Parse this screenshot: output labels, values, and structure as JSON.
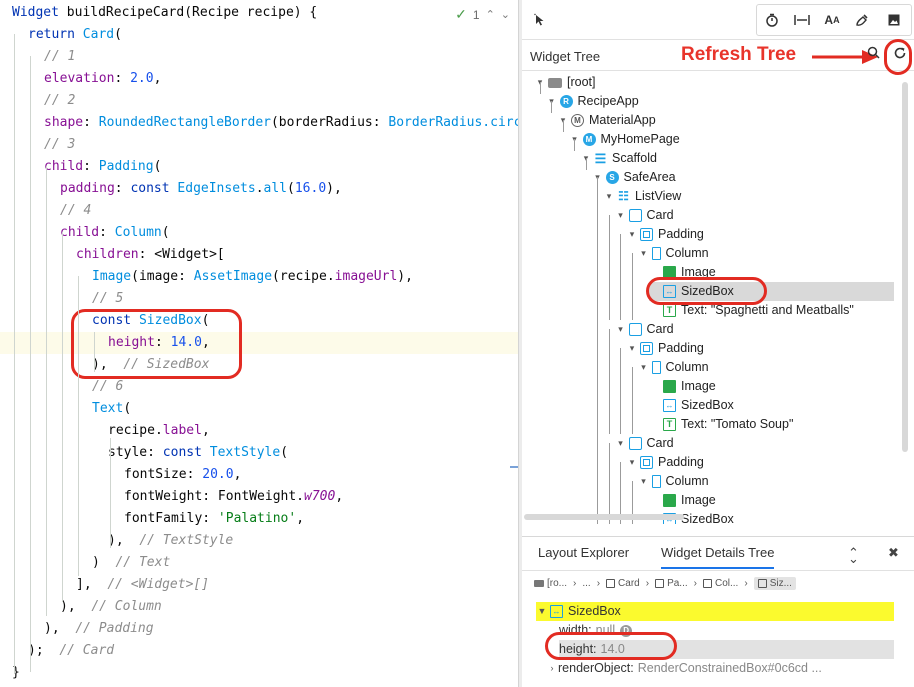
{
  "editor": {
    "status": {
      "warnings": "1"
    },
    "lines": [
      [
        [
          "k",
          "Widget "
        ],
        [
          "",
          "buildRecipeCard(Recipe recipe) {"
        ]
      ],
      [
        [
          "k",
          "return "
        ],
        [
          "t",
          "Card"
        ],
        [
          "",
          "("
        ]
      ],
      [
        [
          "c",
          "// 1"
        ]
      ],
      [
        [
          "p",
          "elevation"
        ],
        [
          "",
          ": "
        ],
        [
          "n",
          "2.0"
        ],
        [
          "",
          ","
        ]
      ],
      [
        [
          "c",
          "// 2"
        ]
      ],
      [
        [
          "p",
          "shape"
        ],
        [
          "",
          ": "
        ],
        [
          "t",
          "RoundedRectangleBorder"
        ],
        [
          "",
          "(borderRadius: "
        ],
        [
          "t",
          "BorderRadius.circ"
        ]
      ],
      [
        [
          "c",
          "// 3"
        ]
      ],
      [
        [
          "p",
          "child"
        ],
        [
          "",
          ": "
        ],
        [
          "t",
          "Padding"
        ],
        [
          "",
          "("
        ]
      ],
      [
        [
          "p",
          "padding"
        ],
        [
          "",
          ": "
        ],
        [
          "k",
          "const "
        ],
        [
          "t",
          "EdgeInsets"
        ],
        [
          "",
          "."
        ],
        [
          "t",
          "all"
        ],
        [
          "",
          "("
        ],
        [
          "n",
          "16.0"
        ],
        [
          "",
          "),"
        ]
      ],
      [
        [
          "c",
          "// 4"
        ]
      ],
      [
        [
          "p",
          "child"
        ],
        [
          "",
          ": "
        ],
        [
          "t",
          "Column"
        ],
        [
          "",
          "("
        ]
      ],
      [
        [
          "p",
          "children"
        ],
        [
          "",
          ": <Widget>["
        ]
      ],
      [
        [
          "t",
          "Image"
        ],
        [
          "",
          "(image: "
        ],
        [
          "t",
          "AssetImage"
        ],
        [
          "",
          "(recipe."
        ],
        [
          "p",
          "imageUrl"
        ],
        [
          "",
          "),"
        ]
      ],
      [
        [
          "c",
          "// 5"
        ]
      ],
      [
        [
          "k",
          "const "
        ],
        [
          "t",
          "SizedBox"
        ],
        [
          "",
          "("
        ]
      ],
      [
        [
          "p",
          "height"
        ],
        [
          "",
          ": "
        ],
        [
          "n",
          "14.0"
        ],
        [
          "",
          ","
        ]
      ],
      [
        [
          "",
          "),  "
        ],
        [
          "c",
          "// SizedBox"
        ]
      ],
      [
        [
          "c",
          "// 6"
        ]
      ],
      [
        [
          "t",
          "Text"
        ],
        [
          "",
          "("
        ]
      ],
      [
        [
          "",
          "recipe."
        ],
        [
          "p",
          "label"
        ],
        [
          "",
          ","
        ]
      ],
      [
        [
          "",
          "style: "
        ],
        [
          "k",
          "const "
        ],
        [
          "t",
          "TextStyle"
        ],
        [
          "",
          "("
        ]
      ],
      [
        [
          "",
          "fontSize: "
        ],
        [
          "n",
          "20.0"
        ],
        [
          "",
          ","
        ]
      ],
      [
        [
          "",
          "fontWeight: FontWeight."
        ],
        [
          "pi",
          "w700"
        ],
        [
          "",
          ","
        ]
      ],
      [
        [
          "",
          "fontFamily: "
        ],
        [
          "s",
          "'Palatino'"
        ],
        [
          "",
          ","
        ]
      ],
      [
        [
          "",
          "),  "
        ],
        [
          "c",
          "// TextStyle"
        ]
      ],
      [
        [
          "",
          ")  "
        ],
        [
          "c",
          "// Text"
        ]
      ],
      [
        [
          "",
          "],  "
        ],
        [
          "c",
          "// <Widget>[]"
        ]
      ],
      [
        [
          "",
          "),  "
        ],
        [
          "c",
          "// Column"
        ]
      ],
      [
        [
          "",
          "),  "
        ],
        [
          "c",
          "// Padding"
        ]
      ],
      [
        [
          "",
          ");  "
        ],
        [
          "c",
          "// Card"
        ]
      ],
      [
        [
          "",
          "}"
        ]
      ]
    ]
  },
  "toolbar": {
    "select_icon": "select-widget-mode-icon",
    "buttons": [
      "timer-icon",
      "baseline-icon",
      "text-size-icon",
      "paint-icon",
      "image-icon"
    ]
  },
  "widget_tree": {
    "title": "Widget Tree",
    "annotation": "Refresh Tree",
    "nodes": [
      {
        "label": "[root]",
        "icon": "folder",
        "level": 0
      },
      {
        "label": "RecipeApp",
        "icon": "circle",
        "level": 1
      },
      {
        "label": "MaterialApp",
        "icon": "circle-o",
        "level": 2
      },
      {
        "label": "MyHomePage",
        "icon": "circle",
        "level": 3
      },
      {
        "label": "Scaffold",
        "icon": "scaffold",
        "level": 4
      },
      {
        "label": "SafeArea",
        "icon": "circle",
        "level": 5
      },
      {
        "label": "ListView",
        "icon": "list",
        "level": 6
      },
      {
        "label": "Card",
        "icon": "card",
        "level": 7
      },
      {
        "label": "Padding",
        "icon": "padding",
        "level": 8
      },
      {
        "label": "Column",
        "icon": "column",
        "level": 9
      },
      {
        "label": "Image",
        "icon": "image",
        "level": 10
      },
      {
        "label": "SizedBox",
        "icon": "sized",
        "level": 10,
        "selected": true
      },
      {
        "label": "Text: \"Spaghetti and Meatballs\"",
        "icon": "text",
        "level": 10
      },
      {
        "label": "Card",
        "icon": "card",
        "level": 7
      },
      {
        "label": "Padding",
        "icon": "padding",
        "level": 8
      },
      {
        "label": "Column",
        "icon": "column",
        "level": 9
      },
      {
        "label": "Image",
        "icon": "image",
        "level": 10
      },
      {
        "label": "SizedBox",
        "icon": "sized",
        "level": 10
      },
      {
        "label": "Text: \"Tomato Soup\"",
        "icon": "text",
        "level": 10
      },
      {
        "label": "Card",
        "icon": "card",
        "level": 7
      },
      {
        "label": "Padding",
        "icon": "padding",
        "level": 8
      },
      {
        "label": "Column",
        "icon": "column",
        "level": 9
      },
      {
        "label": "Image",
        "icon": "image",
        "level": 10
      },
      {
        "label": "SizedBox",
        "icon": "sized",
        "level": 10
      }
    ]
  },
  "bottom": {
    "tabs": [
      "Layout Explorer",
      "Widget Details Tree"
    ],
    "active_tab": 1,
    "breadcrumbs": [
      {
        "label": "[ro...",
        "icon": "folder"
      },
      {
        "label": "...",
        "icon": ""
      },
      {
        "label": "Card",
        "icon": "card"
      },
      {
        "label": "Pa...",
        "icon": "padding"
      },
      {
        "label": "Col...",
        "icon": "column"
      },
      {
        "label": "Siz...",
        "icon": "sized",
        "selected": true
      }
    ],
    "details": {
      "node": "SizedBox",
      "width_key": "width:",
      "width_val": "null",
      "default_badge": "D",
      "height_key": "height:",
      "height_val": "14.0",
      "render_key": "renderObject:",
      "render_val": "RenderConstrainedBox#0c6cd ..."
    }
  }
}
